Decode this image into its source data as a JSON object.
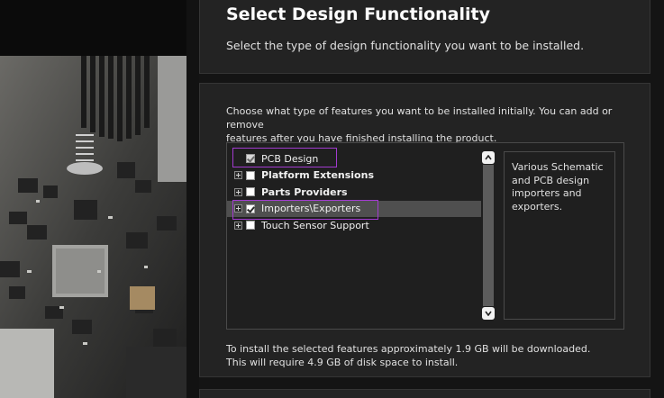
{
  "header": {
    "title": "Select Design Functionality",
    "subtitle": "Select the type of design functionality you want to be installed."
  },
  "features": {
    "intro_line1": "Choose what type of features you want to be installed initially. You can add or remove",
    "intro_line2": "features after you have finished installing the product.",
    "items": [
      {
        "label": "PCB Design",
        "checked": true,
        "greyed": true,
        "expandable": false,
        "bold": false,
        "highlighted": true
      },
      {
        "label": "Platform Extensions",
        "checked": false,
        "greyed": false,
        "expandable": true,
        "bold": true,
        "highlighted": false
      },
      {
        "label": "Parts Providers",
        "checked": false,
        "greyed": false,
        "expandable": true,
        "bold": true,
        "highlighted": false
      },
      {
        "label": "Importers\\Exporters",
        "checked": true,
        "greyed": false,
        "expandable": true,
        "bold": false,
        "highlighted": true
      },
      {
        "label": "Touch Sensor Support",
        "checked": false,
        "greyed": false,
        "expandable": true,
        "bold": false,
        "highlighted": false
      }
    ],
    "description": "Various Schematic and PCB design importers and exporters."
  },
  "footer": {
    "line1": "To install the selected features approximately 1.9 GB will be downloaded.",
    "line2": "This will require 4.9 GB of disk space to install."
  },
  "colors": {
    "highlight": "#a23bd0",
    "panel": "#232323",
    "background": "#141414"
  },
  "icons": [
    "expand-plus-icon",
    "checkbox-icon",
    "scroll-up-icon",
    "scroll-down-icon"
  ]
}
